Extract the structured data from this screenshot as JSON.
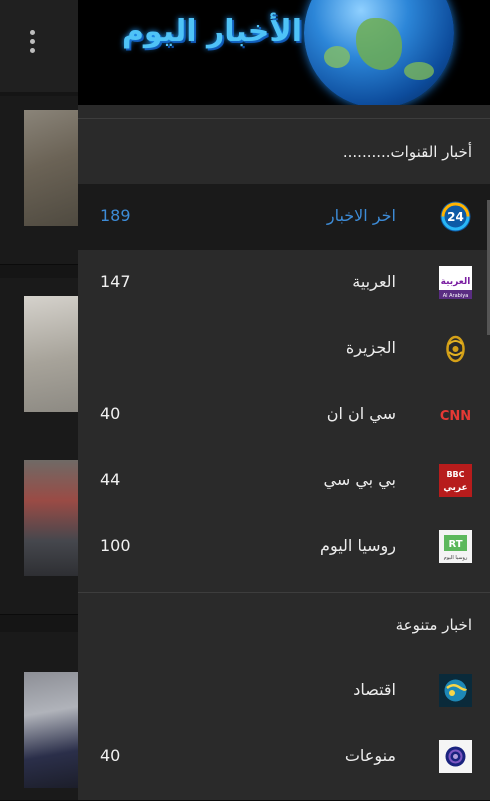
{
  "header": {
    "title": "الأخبار اليوم"
  },
  "sections": [
    {
      "title": "أخبار القنوات..........",
      "items": [
        {
          "label": "اخر الاخبار",
          "count": "189",
          "icon": "news24-logo-icon"
        },
        {
          "label": "العربية",
          "count": "147",
          "icon": "alarabiya-logo-icon"
        },
        {
          "label": "الجزيرة",
          "count": "",
          "icon": "aljazeera-logo-icon"
        },
        {
          "label": "سي ان ان",
          "count": "40",
          "icon": "cnn-logo-icon"
        },
        {
          "label": "بي بي سي",
          "count": "44",
          "icon": "bbc-arabic-logo-icon"
        },
        {
          "label": "روسيا اليوم",
          "count": "100",
          "icon": "rt-logo-icon"
        }
      ]
    },
    {
      "title": "اخبار متنوعة",
      "items": [
        {
          "label": "اقتصاد",
          "count": "",
          "icon": "economy-globe-icon"
        },
        {
          "label": "منوعات",
          "count": "40",
          "icon": "variety-icon"
        }
      ]
    }
  ],
  "logo_text": {
    "news24": "24",
    "alarabiya": "العربية",
    "alarabiya_latin": "Al Arabiya",
    "cnn": "CNN",
    "bbc": "BBC",
    "bbc_arabic": "عربي",
    "rt": "RT",
    "rt_sub": "روسيا اليوم"
  },
  "colors": {
    "selected_text": "#3d8bd6",
    "drawer_bg": "#2a2a2a",
    "selected_bg": "#1a1a1a",
    "title_glow": "#4fc3f7"
  }
}
